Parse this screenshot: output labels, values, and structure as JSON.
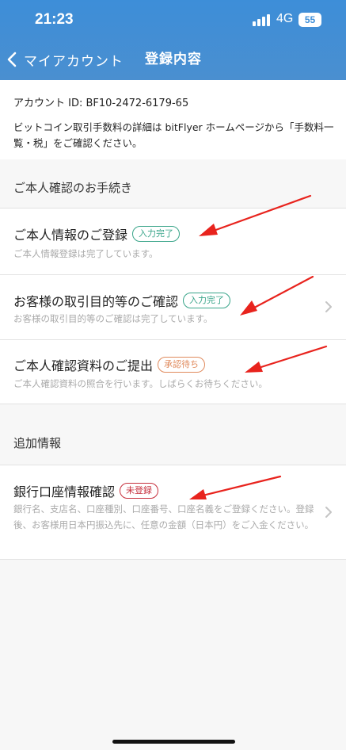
{
  "status_bar": {
    "time": "21:23",
    "network": "4G",
    "battery": "55"
  },
  "nav": {
    "back_label": "マイアカウント",
    "title": "登録内容"
  },
  "account": {
    "id_text": "アカウント ID: BF10-2472-6179-65",
    "fee_note": "ビットコイン取引手数料の詳細は bitFlyer ホームページから「手数料一覧・税」をご確認ください。"
  },
  "identity_section": {
    "header": "ご本人確認のお手続き",
    "items": [
      {
        "title": "ご本人情報のご登録",
        "badge": "入力完了",
        "desc": "ご本人情報登録は完了しています。"
      },
      {
        "title": "お客様の取引目的等のご確認",
        "badge": "入力完了",
        "desc": "お客様の取引目的等のご確認は完了しています。"
      },
      {
        "title": "ご本人確認資料のご提出",
        "badge": "承認待ち",
        "desc": "ご本人確認資料の照合を行います。しばらくお待ちください。"
      }
    ]
  },
  "additional_section": {
    "header": "追加情報",
    "items": [
      {
        "title": "銀行口座情報確認",
        "badge": "未登録",
        "desc": "銀行名、支店名、口座種別、口座番号、口座名義をご登録ください。登録後、お客様用日本円振込先に、任意の金額（日本円）をご入金ください。"
      }
    ]
  },
  "colors": {
    "header": "#3d8ed8",
    "badge_complete": "#3aa58a",
    "badge_pending": "#e08a5c",
    "badge_unregistered": "#c62f3c",
    "annotation_arrow": "#e8231d"
  },
  "icons": [
    "chevron-left-icon",
    "chevron-right-icon",
    "signal-icon",
    "battery-icon"
  ]
}
